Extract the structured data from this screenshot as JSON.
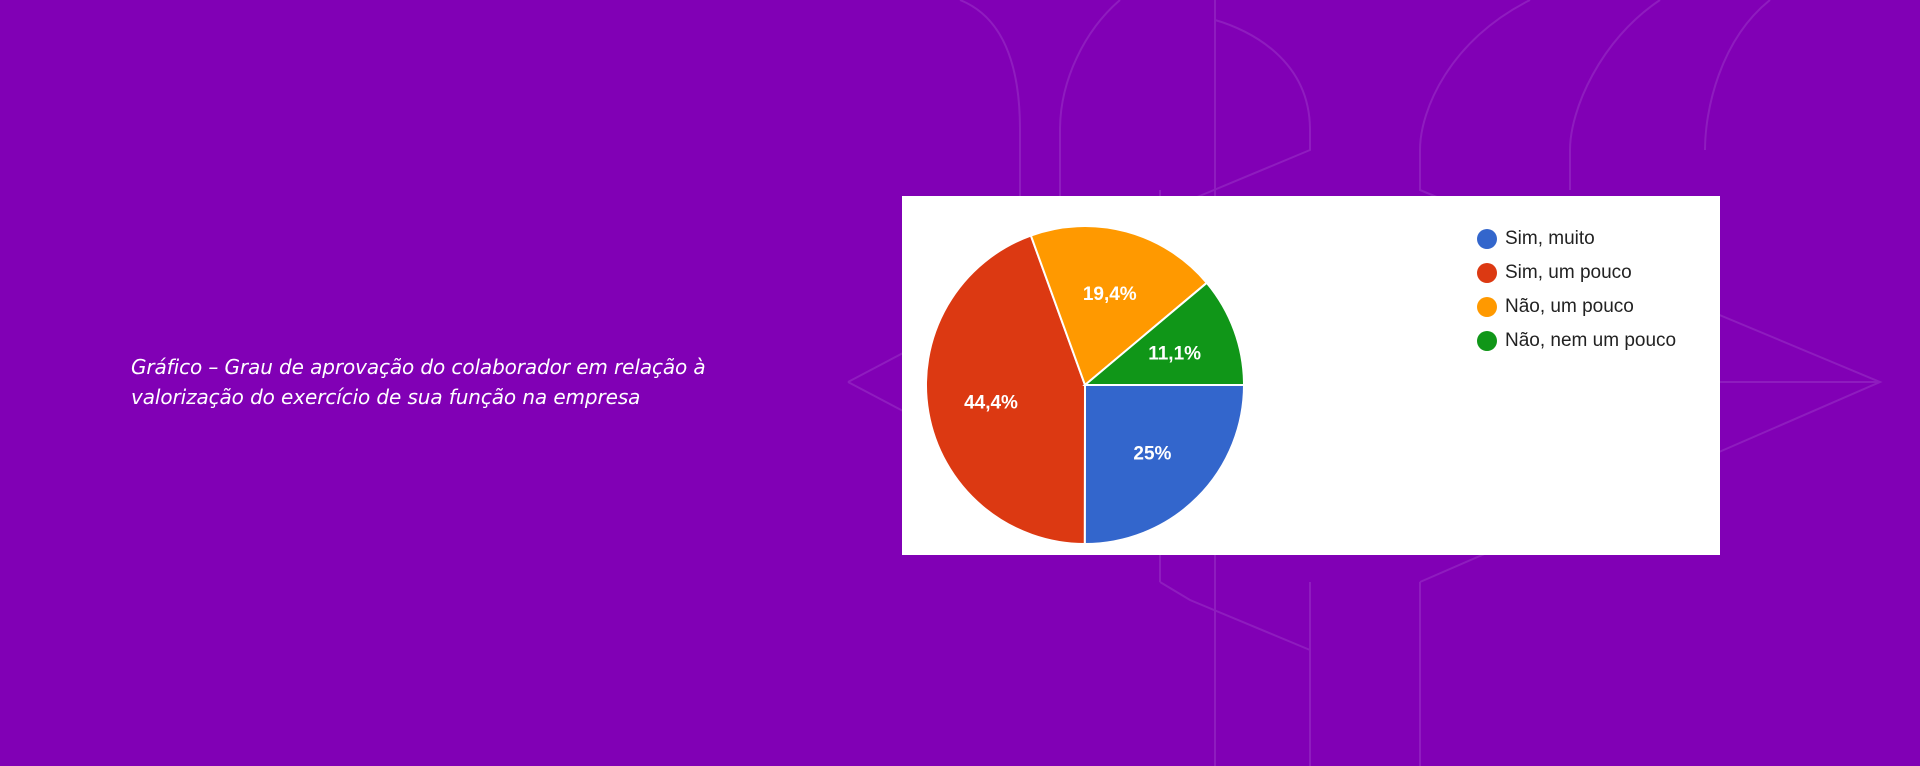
{
  "caption": {
    "line1": "Gráfico – Grau de aprovação do colaborador em relação à",
    "line2": "valorização do exercício de sua função na empresa"
  },
  "colors": {
    "background": "#8100b5",
    "pattern_stroke": "#9a33c7"
  },
  "chart_data": {
    "type": "pie",
    "slices": [
      {
        "label": "Sim, muito",
        "value": 25,
        "display": "25%",
        "color": "#3366cc"
      },
      {
        "label": "Sim, um pouco",
        "value": 44.4,
        "display": "44,4%",
        "color": "#dc3912"
      },
      {
        "label": "Não, um pouco",
        "value": 19.4,
        "display": "19,4%",
        "color": "#ff9900"
      },
      {
        "label": "Não, nem um pouco",
        "value": 11.1,
        "display": "11,1%",
        "color": "#109618"
      }
    ],
    "legend_position": "top-right"
  }
}
